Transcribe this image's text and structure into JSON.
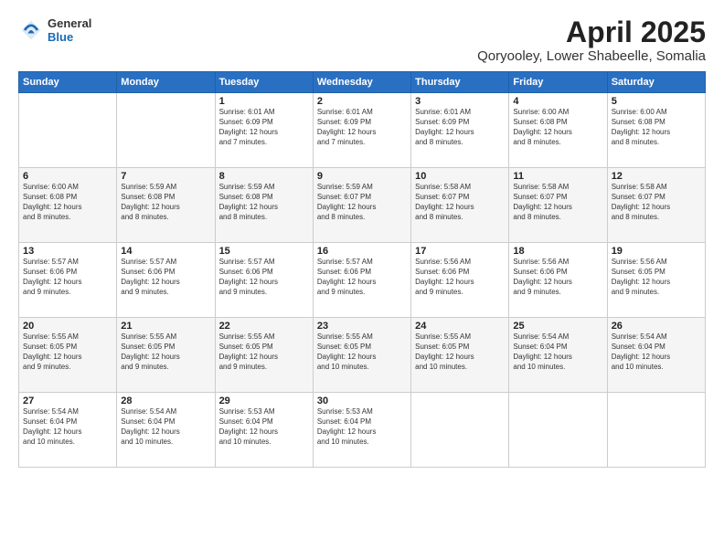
{
  "header": {
    "logo": {
      "general": "General",
      "blue": "Blue"
    },
    "title": "April 2025",
    "location": "Qoryooley, Lower Shabeelle, Somalia"
  },
  "calendar": {
    "weekdays": [
      "Sunday",
      "Monday",
      "Tuesday",
      "Wednesday",
      "Thursday",
      "Friday",
      "Saturday"
    ],
    "rows": [
      [
        {
          "day": "",
          "info": ""
        },
        {
          "day": "",
          "info": ""
        },
        {
          "day": "1",
          "info": "Sunrise: 6:01 AM\nSunset: 6:09 PM\nDaylight: 12 hours\nand 7 minutes."
        },
        {
          "day": "2",
          "info": "Sunrise: 6:01 AM\nSunset: 6:09 PM\nDaylight: 12 hours\nand 7 minutes."
        },
        {
          "day": "3",
          "info": "Sunrise: 6:01 AM\nSunset: 6:09 PM\nDaylight: 12 hours\nand 8 minutes."
        },
        {
          "day": "4",
          "info": "Sunrise: 6:00 AM\nSunset: 6:08 PM\nDaylight: 12 hours\nand 8 minutes."
        },
        {
          "day": "5",
          "info": "Sunrise: 6:00 AM\nSunset: 6:08 PM\nDaylight: 12 hours\nand 8 minutes."
        }
      ],
      [
        {
          "day": "6",
          "info": "Sunrise: 6:00 AM\nSunset: 6:08 PM\nDaylight: 12 hours\nand 8 minutes."
        },
        {
          "day": "7",
          "info": "Sunrise: 5:59 AM\nSunset: 6:08 PM\nDaylight: 12 hours\nand 8 minutes."
        },
        {
          "day": "8",
          "info": "Sunrise: 5:59 AM\nSunset: 6:08 PM\nDaylight: 12 hours\nand 8 minutes."
        },
        {
          "day": "9",
          "info": "Sunrise: 5:59 AM\nSunset: 6:07 PM\nDaylight: 12 hours\nand 8 minutes."
        },
        {
          "day": "10",
          "info": "Sunrise: 5:58 AM\nSunset: 6:07 PM\nDaylight: 12 hours\nand 8 minutes."
        },
        {
          "day": "11",
          "info": "Sunrise: 5:58 AM\nSunset: 6:07 PM\nDaylight: 12 hours\nand 8 minutes."
        },
        {
          "day": "12",
          "info": "Sunrise: 5:58 AM\nSunset: 6:07 PM\nDaylight: 12 hours\nand 8 minutes."
        }
      ],
      [
        {
          "day": "13",
          "info": "Sunrise: 5:57 AM\nSunset: 6:06 PM\nDaylight: 12 hours\nand 9 minutes."
        },
        {
          "day": "14",
          "info": "Sunrise: 5:57 AM\nSunset: 6:06 PM\nDaylight: 12 hours\nand 9 minutes."
        },
        {
          "day": "15",
          "info": "Sunrise: 5:57 AM\nSunset: 6:06 PM\nDaylight: 12 hours\nand 9 minutes."
        },
        {
          "day": "16",
          "info": "Sunrise: 5:57 AM\nSunset: 6:06 PM\nDaylight: 12 hours\nand 9 minutes."
        },
        {
          "day": "17",
          "info": "Sunrise: 5:56 AM\nSunset: 6:06 PM\nDaylight: 12 hours\nand 9 minutes."
        },
        {
          "day": "18",
          "info": "Sunrise: 5:56 AM\nSunset: 6:06 PM\nDaylight: 12 hours\nand 9 minutes."
        },
        {
          "day": "19",
          "info": "Sunrise: 5:56 AM\nSunset: 6:05 PM\nDaylight: 12 hours\nand 9 minutes."
        }
      ],
      [
        {
          "day": "20",
          "info": "Sunrise: 5:55 AM\nSunset: 6:05 PM\nDaylight: 12 hours\nand 9 minutes."
        },
        {
          "day": "21",
          "info": "Sunrise: 5:55 AM\nSunset: 6:05 PM\nDaylight: 12 hours\nand 9 minutes."
        },
        {
          "day": "22",
          "info": "Sunrise: 5:55 AM\nSunset: 6:05 PM\nDaylight: 12 hours\nand 9 minutes."
        },
        {
          "day": "23",
          "info": "Sunrise: 5:55 AM\nSunset: 6:05 PM\nDaylight: 12 hours\nand 10 minutes."
        },
        {
          "day": "24",
          "info": "Sunrise: 5:55 AM\nSunset: 6:05 PM\nDaylight: 12 hours\nand 10 minutes."
        },
        {
          "day": "25",
          "info": "Sunrise: 5:54 AM\nSunset: 6:04 PM\nDaylight: 12 hours\nand 10 minutes."
        },
        {
          "day": "26",
          "info": "Sunrise: 5:54 AM\nSunset: 6:04 PM\nDaylight: 12 hours\nand 10 minutes."
        }
      ],
      [
        {
          "day": "27",
          "info": "Sunrise: 5:54 AM\nSunset: 6:04 PM\nDaylight: 12 hours\nand 10 minutes."
        },
        {
          "day": "28",
          "info": "Sunrise: 5:54 AM\nSunset: 6:04 PM\nDaylight: 12 hours\nand 10 minutes."
        },
        {
          "day": "29",
          "info": "Sunrise: 5:53 AM\nSunset: 6:04 PM\nDaylight: 12 hours\nand 10 minutes."
        },
        {
          "day": "30",
          "info": "Sunrise: 5:53 AM\nSunset: 6:04 PM\nDaylight: 12 hours\nand 10 minutes."
        },
        {
          "day": "",
          "info": ""
        },
        {
          "day": "",
          "info": ""
        },
        {
          "day": "",
          "info": ""
        }
      ]
    ]
  }
}
